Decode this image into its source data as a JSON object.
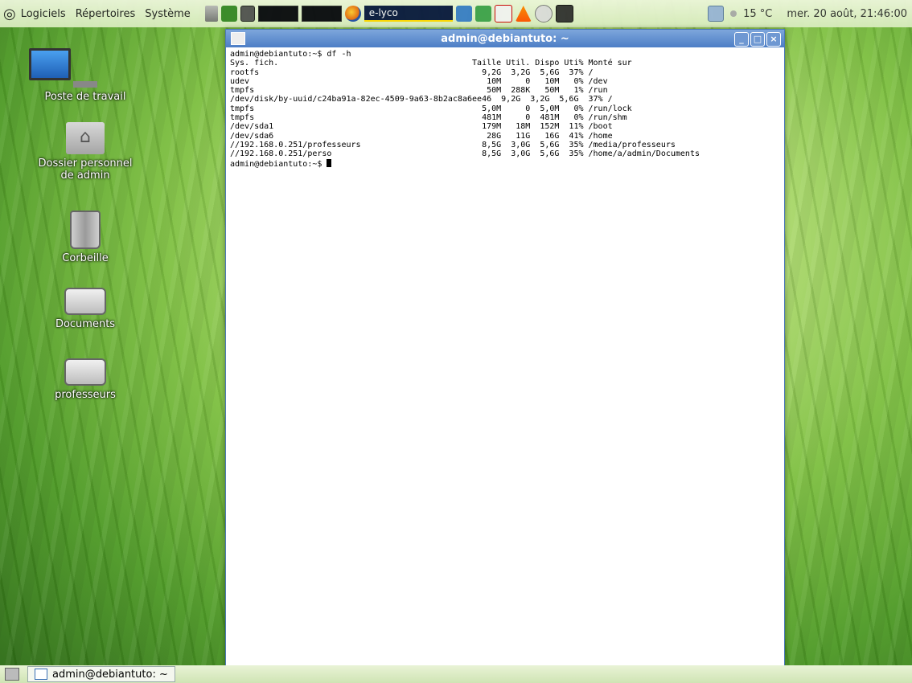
{
  "top_panel": {
    "menu": [
      "Logiciels",
      "Répertoires",
      "Système"
    ],
    "elyco_label": "e-lyco",
    "temperature": "15 °C",
    "clock": "mer. 20 août, 21:46:00"
  },
  "desktop": {
    "icons": [
      {
        "label": "Poste de travail"
      },
      {
        "label": "Dossier personnel\nde admin"
      },
      {
        "label": "Corbeille"
      },
      {
        "label": "Documents"
      },
      {
        "label": "professeurs"
      }
    ]
  },
  "terminal": {
    "title": "admin@debiantuto: ~",
    "lines": [
      "admin@debiantuto:~$ df -h",
      "Sys. fich.                                        Taille Util. Dispo Uti% Monté sur",
      "rootfs                                              9,2G  3,2G  5,6G  37% /",
      "udev                                                 10M     0   10M   0% /dev",
      "tmpfs                                                50M  288K   50M   1% /run",
      "/dev/disk/by-uuid/c24ba91a-82ec-4509-9a63-8b2ac8a6ee46  9,2G  3,2G  5,6G  37% /",
      "tmpfs                                               5,0M     0  5,0M   0% /run/lock",
      "tmpfs                                               481M     0  481M   0% /run/shm",
      "/dev/sda1                                           179M   18M  152M  11% /boot",
      "/dev/sda6                                            28G   11G   16G  41% /home",
      "//192.168.0.251/professeurs                         8,5G  3,0G  5,6G  35% /media/professeurs",
      "//192.168.0.251/perso                               8,5G  3,0G  5,6G  35% /home/a/admin/Documents",
      "admin@debiantuto:~$ "
    ]
  },
  "taskbar": {
    "task_label": "admin@debiantuto: ~"
  }
}
